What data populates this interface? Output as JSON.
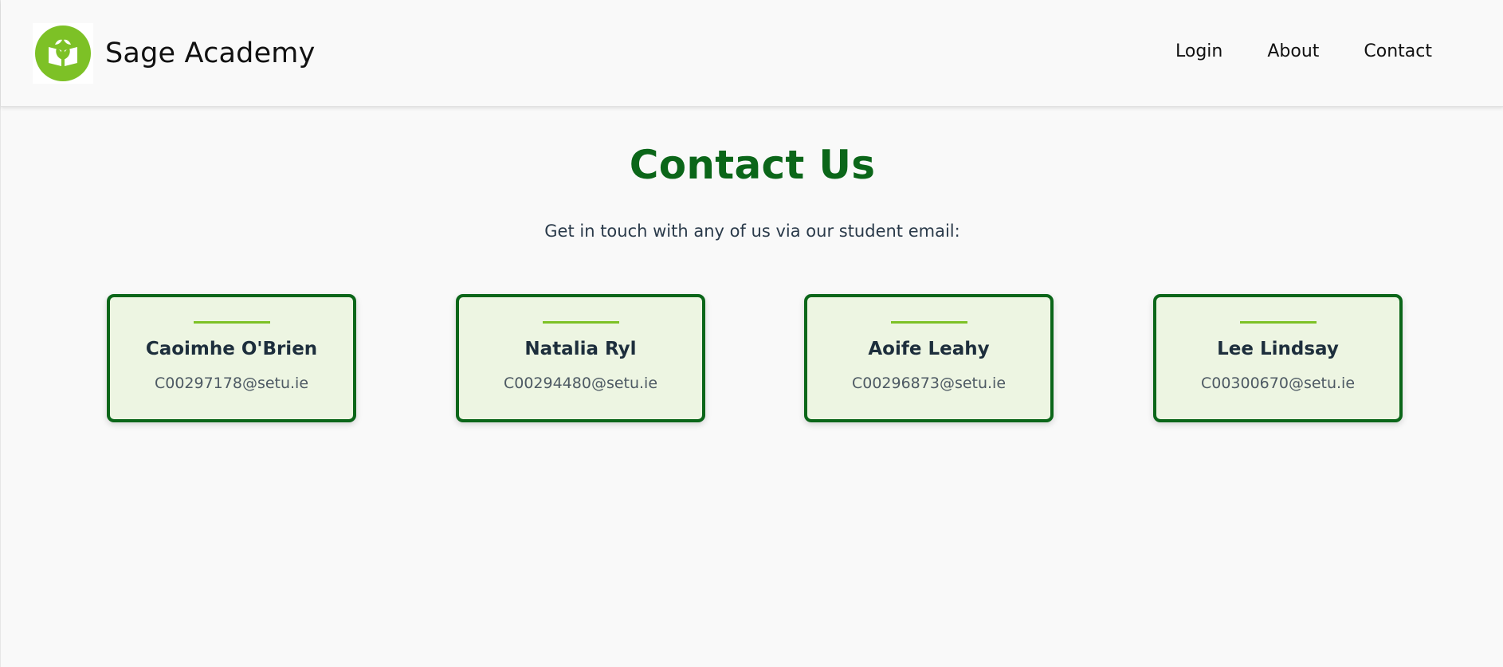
{
  "header": {
    "brand_name": "Sage Academy",
    "logo_icon": "open-book-sprout-icon",
    "nav": [
      {
        "label": "Login"
      },
      {
        "label": "About"
      },
      {
        "label": "Contact"
      }
    ]
  },
  "main": {
    "title": "Contact Us",
    "subtitle": "Get in touch with any of us via our student email:",
    "contacts": [
      {
        "name": "Caoimhe O'Brien",
        "email": "C00297178@setu.ie"
      },
      {
        "name": "Natalia Ryl",
        "email": "C00294480@setu.ie"
      },
      {
        "name": "Aoife Leahy",
        "email": "C00296873@setu.ie"
      },
      {
        "name": "Lee Lindsay",
        "email": "C00300670@setu.ie"
      }
    ]
  },
  "colors": {
    "brand_green": "#0b6619",
    "accent_lime": "#7dc126",
    "card_background": "#edf5e2",
    "page_background": "#f9f9f9"
  }
}
